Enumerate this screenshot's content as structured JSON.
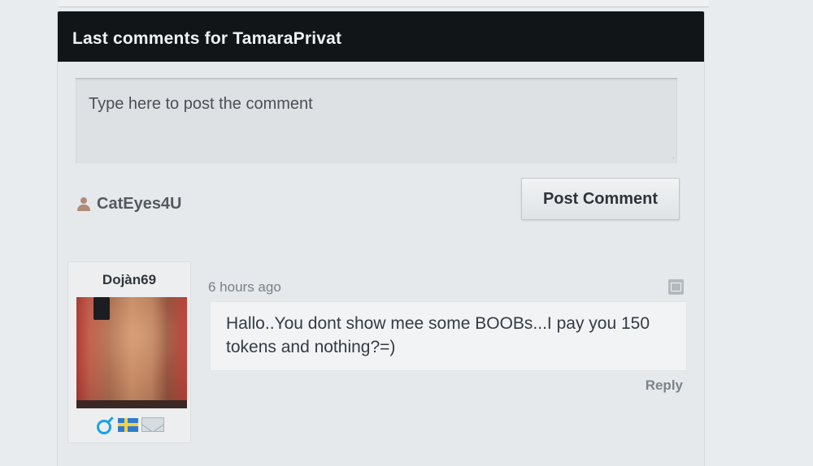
{
  "panel": {
    "title": "Last comments for TamaraPrivat"
  },
  "comment_form": {
    "placeholder": "Type here to post the comment",
    "current_user": "CatEyes4U",
    "post_button_label": "Post Comment"
  },
  "comments": [
    {
      "author": "Dojàn69",
      "time_ago": "6 hours ago",
      "text": "Hallo..You dont show mee some BOOBs...I pay you 150 tokens and nothing?=)",
      "reply_label": "Reply",
      "badges": {
        "gender_icon": "male-symbol",
        "country_flag": "sweden-flag",
        "message_icon": "envelope-icon"
      }
    }
  ],
  "colors": {
    "header_background": "#121517",
    "page_background": "#e9ecee",
    "gender_blue": "#1ba3de",
    "flag_blue": "#2f7ccf",
    "flag_yellow": "#f7d13f"
  }
}
